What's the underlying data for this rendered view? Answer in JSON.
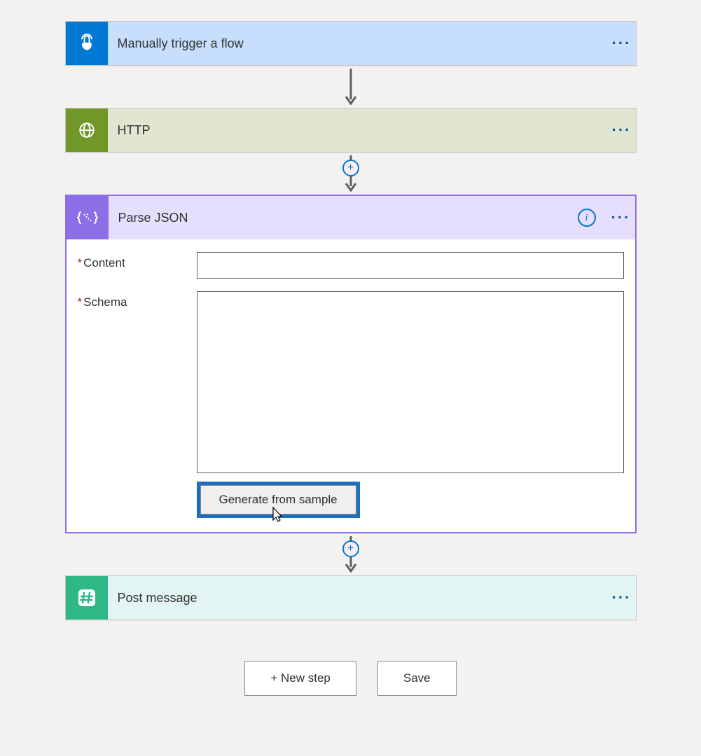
{
  "steps": {
    "trigger": {
      "title": "Manually trigger a flow"
    },
    "http": {
      "title": "HTTP"
    },
    "parseJson": {
      "title": "Parse JSON",
      "fields": {
        "content": {
          "label": "Content",
          "value": ""
        },
        "schema": {
          "label": "Schema",
          "value": ""
        }
      },
      "generateBtn": "Generate from sample"
    },
    "postMessage": {
      "title": "Post message"
    }
  },
  "footer": {
    "newStep": "+ New step",
    "save": "Save"
  }
}
